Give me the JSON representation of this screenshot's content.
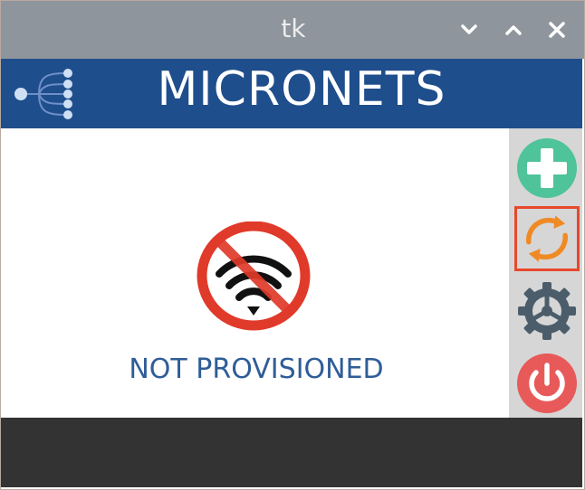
{
  "window": {
    "title": "tk"
  },
  "header": {
    "app_title": "MICRONETS",
    "logo_icon": "network-tree-icon",
    "background_color": "#1f4e8c"
  },
  "main": {
    "status_icon": "wifi-prohibited-icon",
    "status_text": "NOT PROVISIONED",
    "status_color": "#2f5d97"
  },
  "sidebar": {
    "buttons": [
      {
        "name": "add-button",
        "icon": "plus-icon",
        "color": "#4fc39a"
      },
      {
        "name": "refresh-button",
        "icon": "refresh-icon",
        "color": "#f08a24",
        "selected": true
      },
      {
        "name": "settings-button",
        "icon": "gear-icon",
        "color": "#4b5d6b"
      },
      {
        "name": "power-button",
        "icon": "power-icon",
        "color": "#e85a5a"
      }
    ]
  },
  "colors": {
    "titlebar": "#8e959c",
    "footer": "#333333",
    "selection_outline": "#e8482c"
  }
}
